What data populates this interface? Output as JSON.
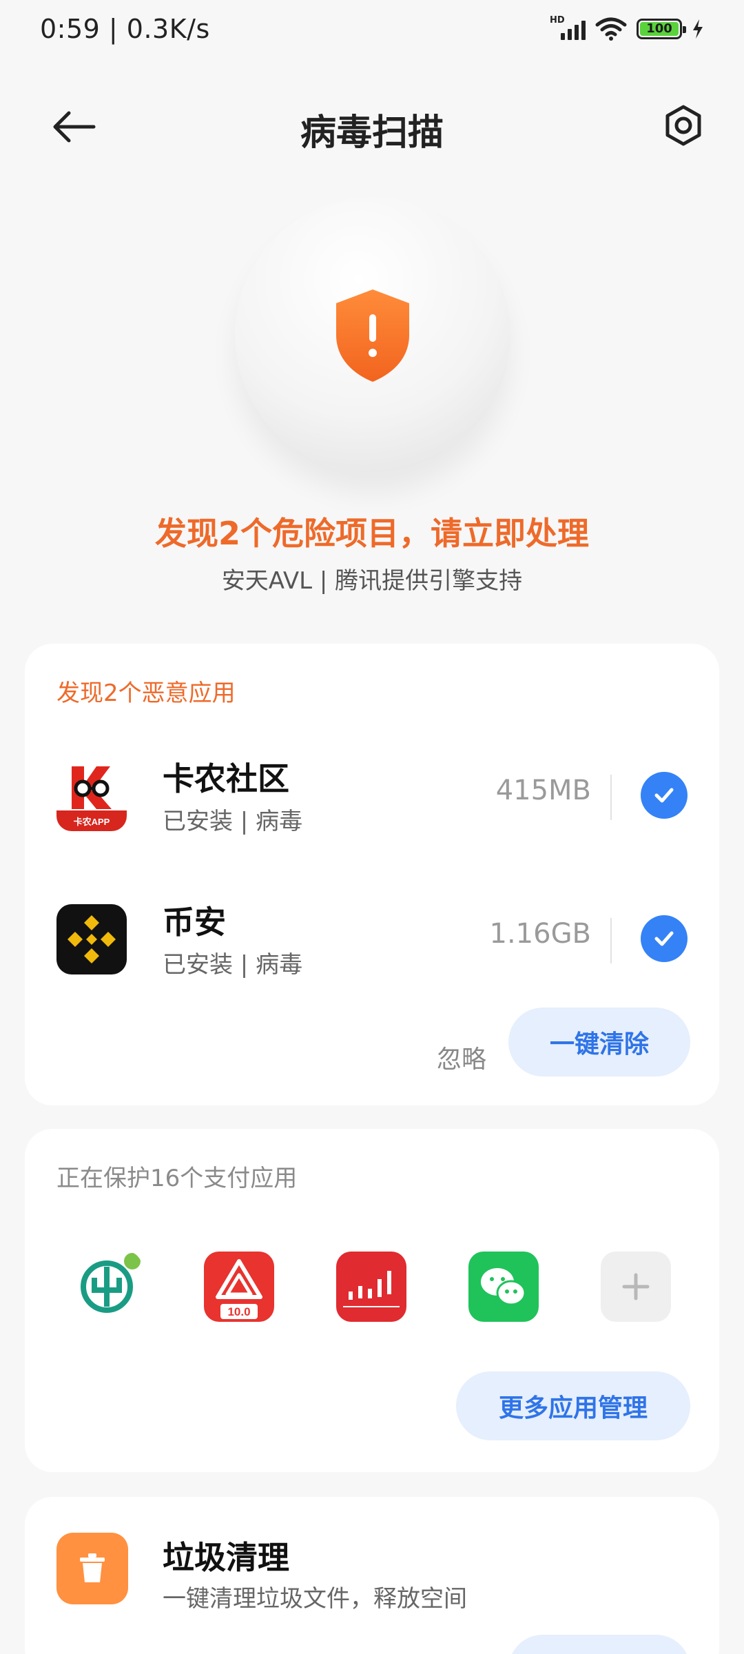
{
  "status_bar": {
    "time_speed": "0:59 | 0.3K/s",
    "network_label": "HD",
    "battery": "100"
  },
  "nav": {
    "title": "病毒扫描"
  },
  "hero": {
    "headline": "发现2个危险项目，请立即处理",
    "engine": "安天AVL | 腾讯提供引擎支持",
    "accent_color": "#ee6a2a"
  },
  "malware_card": {
    "heading": "发现2个恶意应用",
    "apps": [
      {
        "name": "卡农社区",
        "status": "已安装 | 病毒",
        "size": "415MB",
        "checked": true
      },
      {
        "name": "币安",
        "status": "已安装 | 病毒",
        "size": "1.16GB",
        "checked": true
      }
    ],
    "ignore_label": "忽略",
    "clear_label": "一键清除"
  },
  "protect_card": {
    "heading": "正在保护16个支付应用",
    "icons": [
      "agricultural-bank-icon",
      "securities-app-icon",
      "stock-chart-app-icon",
      "wechat-icon",
      "add-icon"
    ],
    "more_label": "更多应用管理"
  },
  "clean_card": {
    "title": "垃圾清理",
    "desc": "一键清理垃圾文件，释放空间"
  },
  "app_icon_text": {
    "kanong_badge": "卡农APP",
    "securities_badge": "10.0"
  },
  "colors": {
    "primary_blue": "#3482f6",
    "button_bg": "#e6effd",
    "button_text": "#2f74e8",
    "clean_orange": "#ff9140"
  }
}
